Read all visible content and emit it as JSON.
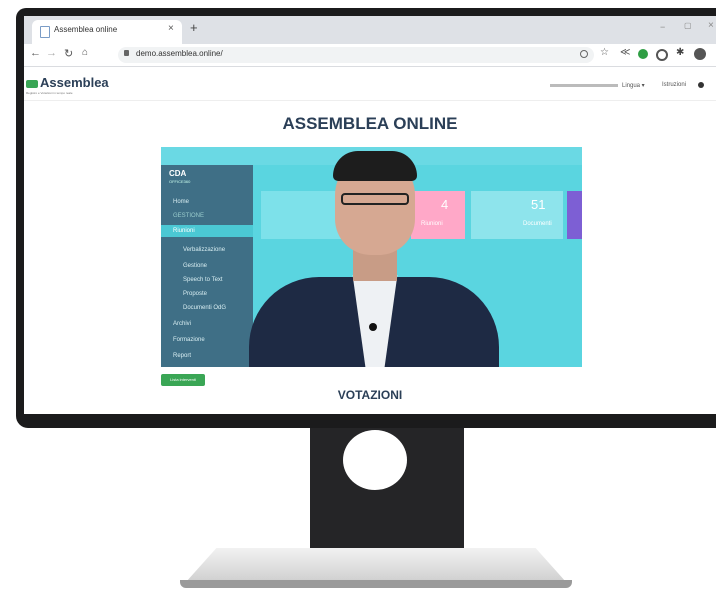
{
  "browser": {
    "tab_title": "Assemblea online",
    "tab_close": "×",
    "new_tab": "+",
    "url": "demo.assemblea.online/",
    "window_minimize": "−",
    "window_restore": "▢",
    "window_close": "×"
  },
  "app": {
    "logo_text": "Assemblea",
    "logo_subtitle": "Registro e Votazioni in tempo reale",
    "language_menu": "Lingua ▾",
    "voting_link": "Istruzioni",
    "page_title": "ASSEMBLEA ONLINE",
    "button_label": "Lista interventi",
    "section_title": "VOTAZIONI"
  },
  "video_app": {
    "logo_line1": "CDA",
    "logo_line2": "OFFICE360",
    "sidebar_items": [
      "Home",
      "GESTIONE",
      "Riunioni",
      "Verbalizzazione",
      "Gestione",
      "Speech to Text",
      "Proposte",
      "Documenti OdG",
      "Archivi",
      "Formazione",
      "Report"
    ],
    "card_value_1": "4",
    "card_label_1": "Riunioni",
    "card_value_2": "51",
    "card_label_2": "Documenti"
  },
  "colors": {
    "brand_green": "#3aa655",
    "title_blue": "#2b3f57",
    "video_cyan": "#5ad5e0",
    "video_sidebar": "#3f6f86"
  }
}
